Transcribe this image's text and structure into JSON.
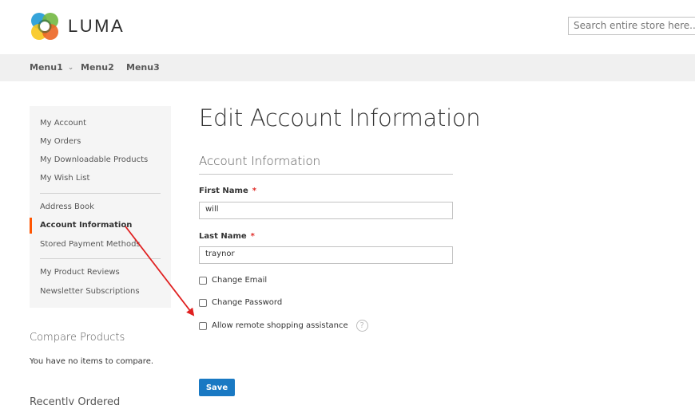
{
  "header": {
    "brand": "LUMA",
    "search_placeholder": "Search entire store here..."
  },
  "nav": {
    "items": [
      {
        "label": "Menu1",
        "has_dropdown": true
      },
      {
        "label": "Menu2",
        "has_dropdown": false
      },
      {
        "label": "Menu3",
        "has_dropdown": false
      }
    ]
  },
  "sidebar": {
    "items": [
      {
        "label": "My Account"
      },
      {
        "label": "My Orders"
      },
      {
        "label": "My Downloadable Products"
      },
      {
        "label": "My Wish List"
      },
      {
        "label": "Address Book"
      },
      {
        "label": "Account Information",
        "active": true
      },
      {
        "label": "Stored Payment Methods"
      },
      {
        "label": "My Product Reviews"
      },
      {
        "label": "Newsletter Subscriptions"
      }
    ],
    "active_color": "#ff5501"
  },
  "compare": {
    "title": "Compare Products",
    "empty_text": "You have no items to compare."
  },
  "recently_ordered": {
    "title": "Recently Ordered"
  },
  "main": {
    "page_title": "Edit Account Information",
    "section_title": "Account Information",
    "fields": {
      "first_name": {
        "label": "First Name",
        "required_mark": "*",
        "value": "will"
      },
      "last_name": {
        "label": "Last Name",
        "required_mark": "*",
        "value": "traynor"
      }
    },
    "checkboxes": [
      {
        "label": "Change Email",
        "checked": false
      },
      {
        "label": "Change Password",
        "checked": false
      },
      {
        "label": "Allow remote shopping assistance",
        "checked": false,
        "has_help": true
      }
    ],
    "help_glyph": "?",
    "save_label": "Save",
    "accent_color": "#1979c3"
  },
  "annotation": {
    "type": "arrow",
    "color": "#e02020",
    "from": "sidebar-item-account-information",
    "to": "checkbox-allow-remote-shopping-assistance"
  }
}
